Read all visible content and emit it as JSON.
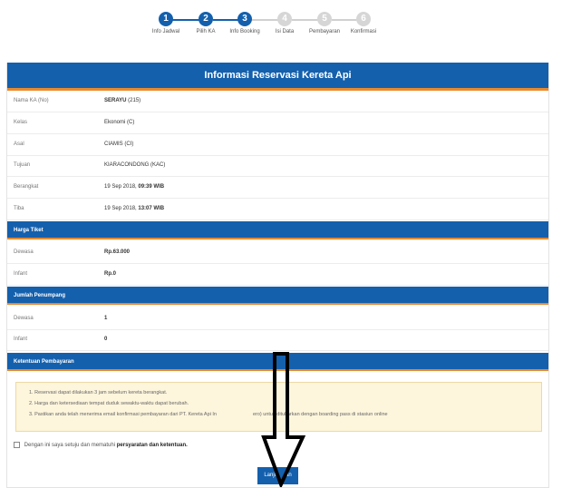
{
  "steps": [
    {
      "num": "1",
      "label": "Info Jadwal",
      "active": true
    },
    {
      "num": "2",
      "label": "Pilih KA",
      "active": true
    },
    {
      "num": "3",
      "label": "Info Booking",
      "active": true
    },
    {
      "num": "4",
      "label": "Isi Data",
      "active": false
    },
    {
      "num": "5",
      "label": "Pembayaran",
      "active": false
    },
    {
      "num": "6",
      "label": "Konfirmasi",
      "active": false
    }
  ],
  "colors": {
    "primary": "#1460ad",
    "accent": "#e9892c",
    "inactive": "#d0d0d0"
  },
  "title": "Informasi Reservasi Kereta Api",
  "info": [
    {
      "key": "Nama KA (No)",
      "value": "SERAYU",
      "extra": "(215)"
    },
    {
      "key": "Kelas",
      "value": "Ekonomi (C)"
    },
    {
      "key": "Asal",
      "value": "CIAMIS (CI)"
    },
    {
      "key": "Tujuan",
      "value": "KIARACONDONG (KAC)"
    },
    {
      "key": "Berangkat",
      "value": "19 Sep 2018,",
      "extra": "09:39 WIB"
    },
    {
      "key": "Tiba",
      "value": "19 Sep 2018,",
      "extra": "13:07 WIB"
    }
  ],
  "harga": {
    "title": "Harga Tiket",
    "rows": [
      {
        "key": "Dewasa",
        "value": "Rp.63.000"
      },
      {
        "key": "Infant",
        "value": "Rp.0"
      }
    ]
  },
  "jumlah": {
    "title": "Jumlah Penumpang",
    "rows": [
      {
        "key": "Dewasa",
        "value": "1"
      },
      {
        "key": "Infant",
        "value": "0"
      }
    ]
  },
  "ketentuan": {
    "title": "Ketentuan Pembayaran",
    "items": [
      "1. Reservasi dapat dilakukan 3 jam sebelum kereta berangkat.",
      "2. Harga dan ketersediaan tempat duduk sewaktu-waktu dapat berubah.",
      "3. Pastikan anda telah menerima email konfirmasi pembayaran dari PT. Kereta Api In",
      "ero) untuk ditukarkan dengan boarding pass di stasiun online"
    ]
  },
  "agree": {
    "prefix": "Dengan ini saya setuju dan mematuhi",
    "link": "persyaratan dan ketentuan."
  },
  "button_label": "Lanju",
  "button_label_tail": "an"
}
